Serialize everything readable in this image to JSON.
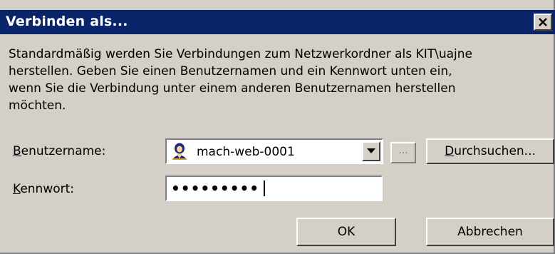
{
  "dialog": {
    "title": "Verbinden als...",
    "description_lines": [
      "Standardmäßig werden Sie Verbindungen zum Netzwerkordner als KIT\\uajne",
      "herstellen. Geben Sie einen Benutzernamen und ein Kennwort unten ein,",
      "wenn Sie die Verbindung unter einem anderen Benutzernamen herstellen",
      "möchten."
    ],
    "username": {
      "label_accel": "B",
      "label_rest": "enutzername:",
      "value": "mach-web-0001",
      "icon": "user-icon"
    },
    "ellipsis_label": "...",
    "browse": {
      "label_accel": "D",
      "label_rest": "urchsuchen..."
    },
    "password": {
      "label_accel": "K",
      "label_rest": "ennwort:",
      "value_masked": "•••••••••"
    },
    "ok_label": "OK",
    "cancel_label": "Abbrechen"
  }
}
